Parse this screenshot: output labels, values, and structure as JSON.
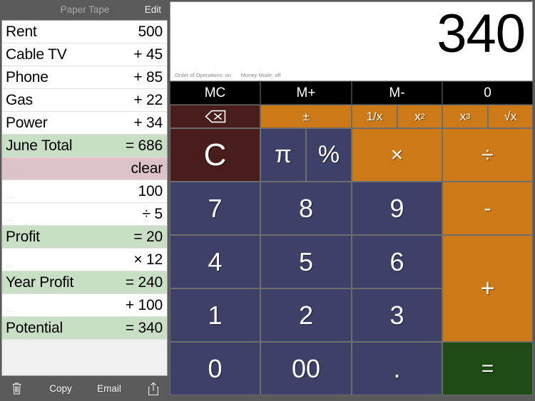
{
  "tape": {
    "title": "Paper Tape",
    "edit_label": "Edit",
    "placeholder": "...",
    "rows": [
      {
        "label": "Rent",
        "value": "500",
        "style": "plain"
      },
      {
        "label": "Cable TV",
        "value": "+ 45",
        "style": "plain"
      },
      {
        "label": "Phone",
        "value": "+ 85",
        "style": "plain"
      },
      {
        "label": "Gas",
        "value": "+ 22",
        "style": "plain"
      },
      {
        "label": "Power",
        "value": "+ 34",
        "style": "plain"
      },
      {
        "label": "June Total",
        "value": "= 686",
        "style": "total"
      },
      {
        "label": "",
        "value": "clear",
        "style": "clear"
      },
      {
        "label": "",
        "value": "100",
        "style": "plain"
      },
      {
        "label": "",
        "value": "÷ 5",
        "style": "plain"
      },
      {
        "label": "Profit",
        "value": "= 20",
        "style": "total"
      },
      {
        "label": "",
        "value": "× 12",
        "style": "plain"
      },
      {
        "label": "Year Profit",
        "value": "= 240",
        "style": "total"
      },
      {
        "label": "",
        "value": "+ 100",
        "style": "plain"
      },
      {
        "label": "Potential",
        "value": "= 340",
        "style": "total"
      }
    ],
    "toolbar": {
      "trash_icon": "trash-icon",
      "copy_label": "Copy",
      "email_label": "Email",
      "share_icon": "share-icon"
    }
  },
  "calculator": {
    "display_value": "340",
    "flags": [
      "Order of Operations: on",
      "Money Mode: off"
    ],
    "memory_row": [
      {
        "label": "MC"
      },
      {
        "label": "M+"
      },
      {
        "label": "M-"
      },
      {
        "label": "0"
      }
    ],
    "keys": {
      "backspace_icon": "backspace-icon",
      "plus_minus": "±",
      "reciprocal": "1/x",
      "square_base": "x",
      "square_exp": "2",
      "cube_base": "x",
      "cube_exp": "3",
      "sqrt": "√x",
      "clear": "C",
      "pi": "π",
      "percent": "%",
      "multiply": "×",
      "divide": "÷",
      "seven": "7",
      "eight": "8",
      "nine": "9",
      "minus": "-",
      "four": "4",
      "five": "5",
      "six": "6",
      "plus": "+",
      "one": "1",
      "two": "2",
      "three": "3",
      "zero": "0",
      "double_zero": "00",
      "decimal": ".",
      "equals": "="
    }
  },
  "colors": {
    "number_key": "#3e4068",
    "operator_key": "#cc7a17",
    "clear_key": "#4a1d1d",
    "equals_key": "#1d4a15",
    "memory_key": "#000000",
    "total_row": "#c9dfc5",
    "clear_row": "#ddc3c7",
    "chrome": "#5a5a5a"
  }
}
